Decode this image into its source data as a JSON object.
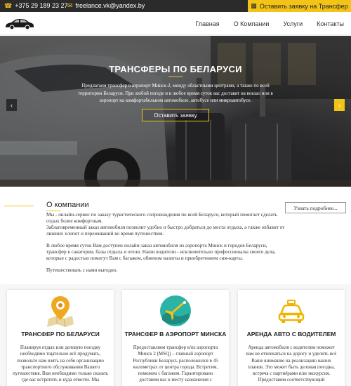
{
  "topbar": {
    "phone": "+375 29 189 23 27",
    "email": "freelance.vk@yandex.by",
    "cta_label": "Оставить заявку на Трансфер"
  },
  "nav": {
    "items": [
      {
        "label": "Главная"
      },
      {
        "label": "О Компании"
      },
      {
        "label": "Услуги"
      },
      {
        "label": "Контакты"
      }
    ]
  },
  "hero": {
    "title": "ТРАНСФЕРЫ ПО БЕЛАРУСИ",
    "text": "Предлагаем трансфер в аэропорт Минск-2, между областными центрами, а также по всей территории Беларуси. При любой погоде и в любое время суток вас доставят на вокзал или в аэропорт на комфортабельном автомобиле, автобусе или микроавтобусе.",
    "button_label": "Оставить заявку",
    "arrow_left": "‹",
    "arrow_right": "›"
  },
  "about": {
    "title": "О компании",
    "more_label": "Узнать подробнее...",
    "p1": "Мы - онлайн-сервис по заказу туристического сопровождения по всей Беларуси, который помогает сделать отдых более комфортным.",
    "p2": "Заблаговременный заказ автомобиля позволит удобно и быстро добраться до места отдыха, а также избавит от лишних хлопот и переживаний во время путешествия.",
    "p3": "В любое время суток Вам доступен онлайн-заказ автомобиля из аэропорта Минск и городов Беларуси, трансфер в санатории, базы отдыха и отели. Наши водители - исключительно профессионалы своего дела, которые с радостью помогут Вам с багажем, обменом валюты и приобретением сим-карты.",
    "p4": "Путешествовать с нами выгодно."
  },
  "cards": [
    {
      "icon": "map-pin-icon",
      "title": "ТРАНСФЕР ПО БЕЛАРУСИ",
      "text": "Планируя отдых или деловую поездку необходимо тщательно всё продумать, позвольте нам взять на себя организацию транспортного обслуживания Вашего путешествия. Вам необходимо только сказать где вас встретить и куда отвезти. Мы"
    },
    {
      "icon": "airplane-icon",
      "title": "ТРАНСФЕР В АЭРОПОРТ МИНСКА",
      "text": "Предоставляем трансфер в/из аэропорта Минск 2 (MSQ) – главный аэропорт Республики Беларусь расположился в 45 километрах от центра города. Встретим, поможем с багажом. Гарантировано доставим вас к месту назначения с"
    },
    {
      "icon": "car-icon",
      "title": "АРЕНДА АВТО С ВОДИТЕЛЕМ",
      "text": "Аренда автомобиля с водителем поможет вам не отвлекаться на дорогу и уделить всё Ваше внимание на реализацию ваших планов. Это может быть деловая поездка, встреча с партнёрами или экскурсия. Предоставим соответствующий"
    }
  ],
  "colors": {
    "accent": "#f3c318",
    "dark": "#2b2b2b"
  }
}
